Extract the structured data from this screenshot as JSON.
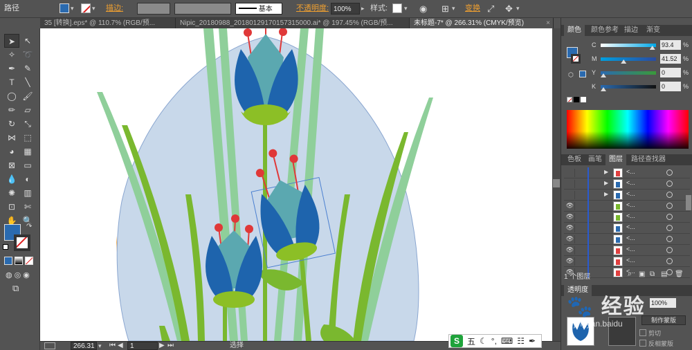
{
  "control_bar": {
    "object_label": "路径",
    "stroke_label": "描边:",
    "stroke_preset": "基本",
    "opacity_label": "不透明度:",
    "opacity_value": "100%",
    "style_label": "样式:",
    "transform_label": "变换",
    "fill_color": "#2a6aaf"
  },
  "tabs": [
    {
      "label": "35 [转换].eps* @ 110.7% (RGB/预..."
    },
    {
      "label": "Nipic_20180988_20180129170157315000.ai* @ 197.45% (RGB/预..."
    },
    {
      "label": "未标题-7* @ 266.31% (CMYK/预览)"
    }
  ],
  "status_bar": {
    "zoom": "266.31",
    "artboard": "1",
    "tool_status": "选择"
  },
  "ime": {
    "logo": "S",
    "mode": "五"
  },
  "color_panel": {
    "tabs": [
      "颜色",
      "颜色参考",
      "描边",
      "渐变"
    ],
    "channels": [
      {
        "letter": "C",
        "value": "93.4",
        "fraction": 0.934
      },
      {
        "letter": "M",
        "value": "41.52",
        "fraction": 0.4152
      },
      {
        "letter": "Y",
        "value": "0",
        "fraction": 0
      },
      {
        "letter": "K",
        "value": "0",
        "fraction": 0
      }
    ],
    "pct": "%"
  },
  "layers_panel": {
    "tabs": [
      "色板",
      "画笔",
      "图层",
      "路径查找器"
    ],
    "rows": [
      {
        "name": "<...",
        "visible": false,
        "expandable": true,
        "thumb_color": "#e04040"
      },
      {
        "name": "<...",
        "visible": false,
        "expandable": true,
        "thumb_color": "#2a6aaf"
      },
      {
        "name": "<...",
        "visible": false,
        "expandable": true,
        "thumb_color": "#2a6aaf"
      },
      {
        "name": "<...",
        "visible": true,
        "expandable": false,
        "thumb_color": "#7ab82f"
      },
      {
        "name": "<...",
        "visible": true,
        "expandable": false,
        "thumb_color": "#7ab82f"
      },
      {
        "name": "<...",
        "visible": true,
        "expandable": false,
        "thumb_color": "#2a6aaf"
      },
      {
        "name": "<...",
        "visible": true,
        "expandable": false,
        "thumb_color": "#2a6aaf"
      },
      {
        "name": "<...",
        "visible": true,
        "expandable": false,
        "thumb_color": "#e04040"
      },
      {
        "name": "<...",
        "visible": true,
        "expandable": false,
        "thumb_color": "#e04040"
      },
      {
        "name": "<...",
        "visible": true,
        "expandable": false,
        "thumb_color": "#e04040"
      }
    ],
    "footer": "1 个图层"
  },
  "transparency_panel": {
    "tab": "透明度",
    "opacity_value": "100%",
    "make_mask_button": "制作蒙版",
    "clip_label": "剪切",
    "invert_label": "反相蒙版"
  },
  "watermark": {
    "text": "经验",
    "site": "jingyan.baidu"
  },
  "colors": {
    "bg_shape": "#c8d8ea",
    "stem_light": "#8fcf9a",
    "stem_green": "#7ab82f",
    "petal_blue": "#1e64ad",
    "petal_teal": "#5ba8b0",
    "bud_green": "#8cbf26",
    "stamen_red": "#e03838",
    "orange": "#f59a1e"
  }
}
